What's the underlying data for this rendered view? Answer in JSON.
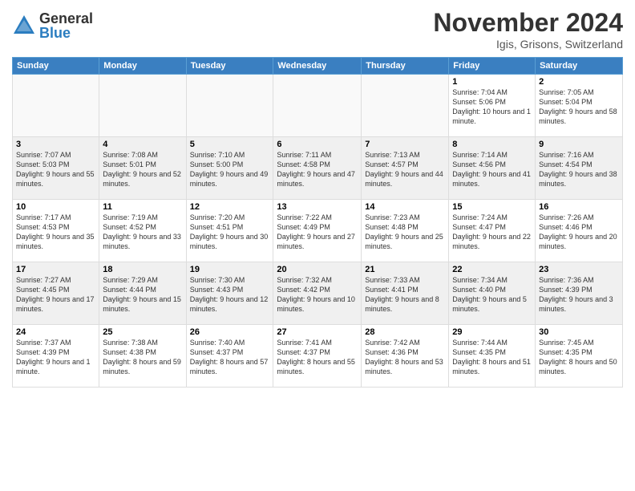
{
  "header": {
    "logo_general": "General",
    "logo_blue": "Blue",
    "month_title": "November 2024",
    "location": "Igis, Grisons, Switzerland"
  },
  "weekdays": [
    "Sunday",
    "Monday",
    "Tuesday",
    "Wednesday",
    "Thursday",
    "Friday",
    "Saturday"
  ],
  "weeks": [
    [
      {
        "day": "",
        "info": ""
      },
      {
        "day": "",
        "info": ""
      },
      {
        "day": "",
        "info": ""
      },
      {
        "day": "",
        "info": ""
      },
      {
        "day": "",
        "info": ""
      },
      {
        "day": "1",
        "info": "Sunrise: 7:04 AM\nSunset: 5:06 PM\nDaylight: 10 hours and 1 minute."
      },
      {
        "day": "2",
        "info": "Sunrise: 7:05 AM\nSunset: 5:04 PM\nDaylight: 9 hours and 58 minutes."
      }
    ],
    [
      {
        "day": "3",
        "info": "Sunrise: 7:07 AM\nSunset: 5:03 PM\nDaylight: 9 hours and 55 minutes."
      },
      {
        "day": "4",
        "info": "Sunrise: 7:08 AM\nSunset: 5:01 PM\nDaylight: 9 hours and 52 minutes."
      },
      {
        "day": "5",
        "info": "Sunrise: 7:10 AM\nSunset: 5:00 PM\nDaylight: 9 hours and 49 minutes."
      },
      {
        "day": "6",
        "info": "Sunrise: 7:11 AM\nSunset: 4:58 PM\nDaylight: 9 hours and 47 minutes."
      },
      {
        "day": "7",
        "info": "Sunrise: 7:13 AM\nSunset: 4:57 PM\nDaylight: 9 hours and 44 minutes."
      },
      {
        "day": "8",
        "info": "Sunrise: 7:14 AM\nSunset: 4:56 PM\nDaylight: 9 hours and 41 minutes."
      },
      {
        "day": "9",
        "info": "Sunrise: 7:16 AM\nSunset: 4:54 PM\nDaylight: 9 hours and 38 minutes."
      }
    ],
    [
      {
        "day": "10",
        "info": "Sunrise: 7:17 AM\nSunset: 4:53 PM\nDaylight: 9 hours and 35 minutes."
      },
      {
        "day": "11",
        "info": "Sunrise: 7:19 AM\nSunset: 4:52 PM\nDaylight: 9 hours and 33 minutes."
      },
      {
        "day": "12",
        "info": "Sunrise: 7:20 AM\nSunset: 4:51 PM\nDaylight: 9 hours and 30 minutes."
      },
      {
        "day": "13",
        "info": "Sunrise: 7:22 AM\nSunset: 4:49 PM\nDaylight: 9 hours and 27 minutes."
      },
      {
        "day": "14",
        "info": "Sunrise: 7:23 AM\nSunset: 4:48 PM\nDaylight: 9 hours and 25 minutes."
      },
      {
        "day": "15",
        "info": "Sunrise: 7:24 AM\nSunset: 4:47 PM\nDaylight: 9 hours and 22 minutes."
      },
      {
        "day": "16",
        "info": "Sunrise: 7:26 AM\nSunset: 4:46 PM\nDaylight: 9 hours and 20 minutes."
      }
    ],
    [
      {
        "day": "17",
        "info": "Sunrise: 7:27 AM\nSunset: 4:45 PM\nDaylight: 9 hours and 17 minutes."
      },
      {
        "day": "18",
        "info": "Sunrise: 7:29 AM\nSunset: 4:44 PM\nDaylight: 9 hours and 15 minutes."
      },
      {
        "day": "19",
        "info": "Sunrise: 7:30 AM\nSunset: 4:43 PM\nDaylight: 9 hours and 12 minutes."
      },
      {
        "day": "20",
        "info": "Sunrise: 7:32 AM\nSunset: 4:42 PM\nDaylight: 9 hours and 10 minutes."
      },
      {
        "day": "21",
        "info": "Sunrise: 7:33 AM\nSunset: 4:41 PM\nDaylight: 9 hours and 8 minutes."
      },
      {
        "day": "22",
        "info": "Sunrise: 7:34 AM\nSunset: 4:40 PM\nDaylight: 9 hours and 5 minutes."
      },
      {
        "day": "23",
        "info": "Sunrise: 7:36 AM\nSunset: 4:39 PM\nDaylight: 9 hours and 3 minutes."
      }
    ],
    [
      {
        "day": "24",
        "info": "Sunrise: 7:37 AM\nSunset: 4:39 PM\nDaylight: 9 hours and 1 minute."
      },
      {
        "day": "25",
        "info": "Sunrise: 7:38 AM\nSunset: 4:38 PM\nDaylight: 8 hours and 59 minutes."
      },
      {
        "day": "26",
        "info": "Sunrise: 7:40 AM\nSunset: 4:37 PM\nDaylight: 8 hours and 57 minutes."
      },
      {
        "day": "27",
        "info": "Sunrise: 7:41 AM\nSunset: 4:37 PM\nDaylight: 8 hours and 55 minutes."
      },
      {
        "day": "28",
        "info": "Sunrise: 7:42 AM\nSunset: 4:36 PM\nDaylight: 8 hours and 53 minutes."
      },
      {
        "day": "29",
        "info": "Sunrise: 7:44 AM\nSunset: 4:35 PM\nDaylight: 8 hours and 51 minutes."
      },
      {
        "day": "30",
        "info": "Sunrise: 7:45 AM\nSunset: 4:35 PM\nDaylight: 8 hours and 50 minutes."
      }
    ]
  ]
}
